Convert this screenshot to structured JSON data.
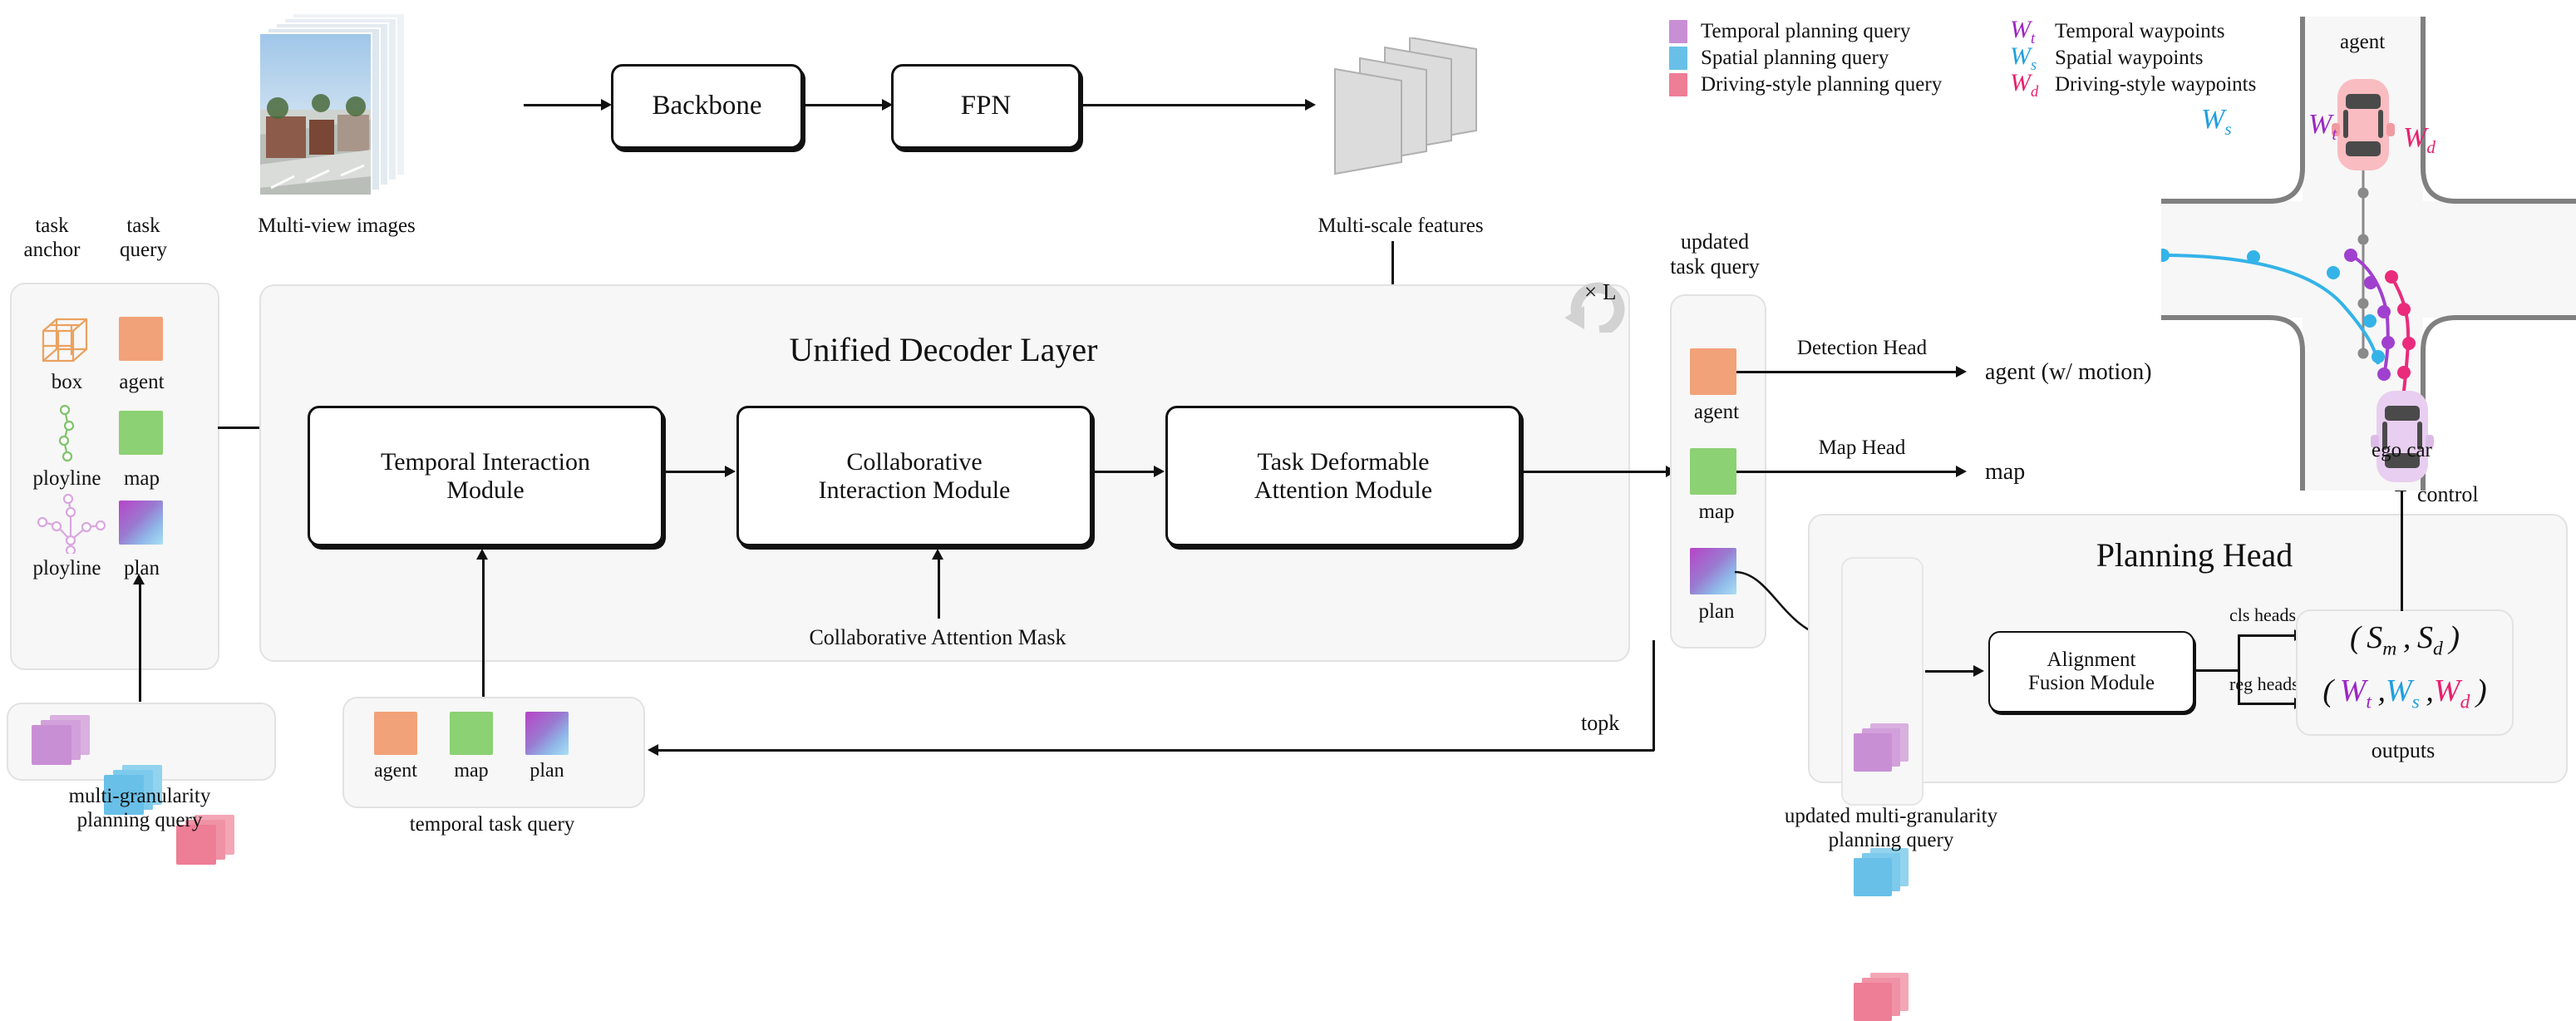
{
  "pipeline": {
    "multiview_label": "Multi-view images",
    "backbone_label": "Backbone",
    "fpn_label": "FPN",
    "features_label": "Multi-scale features"
  },
  "left_columns": {
    "task_anchor_label": "task\nanchor",
    "task_anchor_line1": "task",
    "task_anchor_line2": "anchor",
    "task_query_line1": "task",
    "task_query_line2": "query",
    "rows": [
      {
        "anchor_icon": "box-wireframe-icon",
        "anchor_label": "box",
        "query_label": "agent",
        "query_color": "#f2a278"
      },
      {
        "anchor_icon": "polyline-chain-icon",
        "anchor_label": "ployline",
        "query_label": "map",
        "query_color": "#8cd173"
      },
      {
        "anchor_icon": "polyline-tree-icon",
        "anchor_label": "ployline",
        "query_label": "plan",
        "query_color": "gradient-purple-blue"
      }
    ]
  },
  "multi_granularity": {
    "caption_line1": "multi-granularity",
    "caption_line2": "planning query",
    "chips": [
      {
        "name": "temporal-planning-query-stack",
        "color": "#c98fd4"
      },
      {
        "name": "spatial-planning-query-stack",
        "color": "#68c0e8"
      },
      {
        "name": "driving-style-planning-query-stack",
        "color": "#ee7d96"
      }
    ]
  },
  "decoder": {
    "title": "Unified Decoder Layer",
    "loop_label": "× L",
    "modules": [
      {
        "line1": "Temporal Interaction",
        "line2": "Module"
      },
      {
        "line1": "Collaborative",
        "line2": "Interaction Module"
      },
      {
        "line1": "Task Deformable",
        "line2": "Attention Module"
      }
    ],
    "mask_label": "Collaborative Attention Mask"
  },
  "temporal_task_query": {
    "caption": "temporal task query",
    "items": [
      {
        "label": "agent",
        "color": "#f2a278"
      },
      {
        "label": "map",
        "color": "#8cd173"
      },
      {
        "label": "plan",
        "color": "gradient-purple-blue"
      }
    ]
  },
  "updated_task_query": {
    "caption_line1": "updated",
    "caption_line2": "task  query",
    "items": [
      {
        "label": "agent",
        "color": "#f2a278"
      },
      {
        "label": "map",
        "color": "#8cd173"
      },
      {
        "label": "plan",
        "color": "gradient-purple-blue"
      }
    ]
  },
  "heads": {
    "detection_head": "Detection Head",
    "detection_output": "agent  (w/ motion)",
    "map_head": "Map Head",
    "map_output": "map",
    "topk_label": "topk"
  },
  "planning_head": {
    "title": "Planning Head",
    "queries_caption_line1": "updated multi-granularity",
    "queries_caption_line2": "planning query",
    "fusion_line1": "Alignment",
    "fusion_line2": "Fusion Module",
    "cls_heads_label": "cls heads",
    "reg_heads_label": "reg heads",
    "outputs_caption": "outputs",
    "output_cls": "( S_m , S_d )",
    "output_reg": "( W_t , W_s , W_d )"
  },
  "legend": {
    "left": [
      {
        "swatch": "#c98fd4",
        "text": "Temporal planning query"
      },
      {
        "swatch": "#68c0e8",
        "text": "Spatial planning query"
      },
      {
        "swatch": "#ee7d96",
        "text": "Driving-style planning query"
      }
    ],
    "right": [
      {
        "symbol": "W",
        "sub": "t",
        "color": "#9b26c4",
        "text": "Temporal waypoints"
      },
      {
        "symbol": "W",
        "sub": "s",
        "color": "#1f9fe0",
        "text": "Spatial waypoints"
      },
      {
        "symbol": "W",
        "sub": "d",
        "color": "#e8206e",
        "text": "Driving-style waypoints"
      }
    ]
  },
  "scene": {
    "agent_label": "agent",
    "ego_label": "ego car",
    "control_label": "control",
    "wt_label": "W_t",
    "ws_label": "W_s",
    "wd_label": "W_d",
    "wt_color": "#9b26c4",
    "ws_color": "#1f9fe0",
    "wd_color": "#e8206e",
    "agent_car_color": "#f9bcc0",
    "ego_car_color": "#e8cef0",
    "road_color": "#f7f7f7",
    "curb_color": "#808080"
  }
}
